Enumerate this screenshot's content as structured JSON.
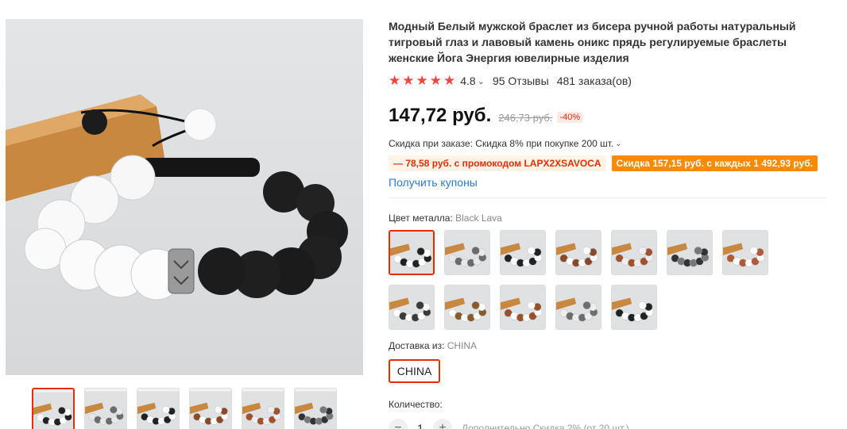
{
  "product": {
    "title": "Модный Белый мужской браслет из бисера ручной работы натуральный тигровый глаз и лавовый камень оникс прядь регулируемые браслеты женские Йога Энергия ювелирные изделия",
    "rating": "4.8",
    "reviews": "95 Отзывы",
    "orders": "481 заказа(ов)",
    "star_count": 5
  },
  "price": {
    "current": "147,72 руб.",
    "old": "246,73 руб.",
    "discount": "-40%"
  },
  "promotions": {
    "order_discount": "Скидка при заказе: Скидка 8% при покупке 200 шт.",
    "promo_code": "— 78,58 руб. с промокодом LAPX2XSAVOCA",
    "store_discount": "Скидка 157,15 руб. с каждых 1 492,93 руб.",
    "coupons_link": "Получить купоны"
  },
  "color": {
    "label": "Цвет металла:",
    "value": "Black Lava",
    "selected_index": 0,
    "options": [
      {
        "name": "swatch-1",
        "beads": [
          "#fff",
          "#222",
          "#fff",
          "#222"
        ]
      },
      {
        "name": "swatch-2",
        "beads": [
          "#e8e8e8",
          "#6b6b6b",
          "#e8e8e8",
          "#6b6b6b"
        ]
      },
      {
        "name": "swatch-3",
        "beads": [
          "#222",
          "#fff",
          "#222",
          "#fff"
        ]
      },
      {
        "name": "swatch-4",
        "beads": [
          "#8a4a2a",
          "#fff",
          "#8a4a2a",
          "#fff"
        ]
      },
      {
        "name": "swatch-5",
        "beads": [
          "#a0522d",
          "#eee",
          "#a0522d",
          "#eee"
        ]
      },
      {
        "name": "swatch-6",
        "beads": [
          "#333",
          "#777",
          "#333",
          "#777"
        ]
      },
      {
        "name": "swatch-7",
        "beads": [
          "#b05a3a",
          "#fff",
          "#b05a3a",
          "#fff"
        ]
      },
      {
        "name": "swatch-8",
        "beads": [
          "#fff",
          "#3a3a3a",
          "#fff",
          "#3a3a3a"
        ]
      },
      {
        "name": "swatch-9",
        "beads": [
          "#fff",
          "#8b5a2b",
          "#fff",
          "#8b5a2b"
        ]
      },
      {
        "name": "swatch-10",
        "beads": [
          "#9b4f2c",
          "#fff",
          "#9b4f2c",
          "#fff"
        ]
      },
      {
        "name": "swatch-11",
        "beads": [
          "#eee",
          "#6d6d6d",
          "#eee",
          "#6d6d6d"
        ]
      },
      {
        "name": "swatch-12",
        "beads": [
          "#222",
          "#fff",
          "#222",
          "#fff"
        ]
      }
    ]
  },
  "shipping": {
    "label": "Доставка из:",
    "value": "CHINA",
    "option": "CHINA"
  },
  "quantity": {
    "label": "Количество:",
    "minus": "−",
    "value": "1",
    "plus": "+",
    "note": "Дополнительно Скидка 2% (от 20 шт.)"
  },
  "icons": {
    "star": "★",
    "chevron": "⌄"
  },
  "colors": {
    "accent": "#e62e04",
    "star": "#f2453d",
    "promo_orange": "#ff8a00",
    "link": "#2a7bd6"
  }
}
